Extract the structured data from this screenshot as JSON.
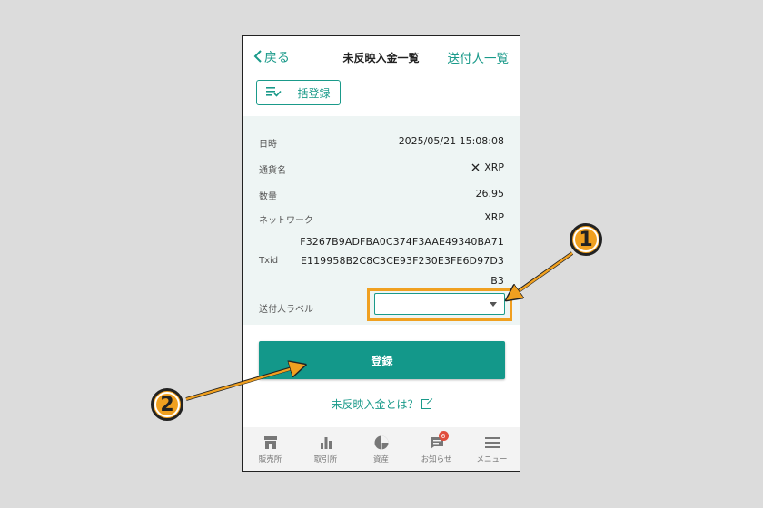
{
  "header": {
    "back_label": "戻る",
    "title": "未反映入金一覧",
    "sender_list_label": "送付人一覧"
  },
  "bulk_register_label": "一括登録",
  "details": {
    "datetime_label": "日時",
    "datetime_value": "2025/05/21 15:08:08",
    "currency_label": "通貨名",
    "currency_value": "XRP",
    "quantity_label": "数量",
    "quantity_value": "26.95",
    "network_label": "ネットワーク",
    "network_value": "XRP",
    "txid_label": "Txid",
    "txid_lines": [
      "F3267B9ADFBA0C374F3AAE49340BA71",
      "E119958B2C8C3CE93F230E3FE6D97D3",
      "B3"
    ],
    "sender_label_label": "送付人ラベル",
    "sender_label_value": ""
  },
  "register_label": "登録",
  "help_link_label": "未反映入金とは？",
  "bottom_nav": [
    {
      "label": "販売所",
      "icon": "store-icon"
    },
    {
      "label": "取引所",
      "icon": "bar-chart-icon"
    },
    {
      "label": "資産",
      "icon": "pie-chart-icon"
    },
    {
      "label": "お知らせ",
      "icon": "message-icon",
      "badge": "6"
    },
    {
      "label": "メニュー",
      "icon": "menu-icon"
    }
  ],
  "annotations": {
    "callout_1": "1",
    "callout_2": "2"
  },
  "colors": {
    "accent": "#1a9a8a",
    "primary_button": "#13988a",
    "callout": "#f0a020",
    "badge": "#e04d3c"
  }
}
